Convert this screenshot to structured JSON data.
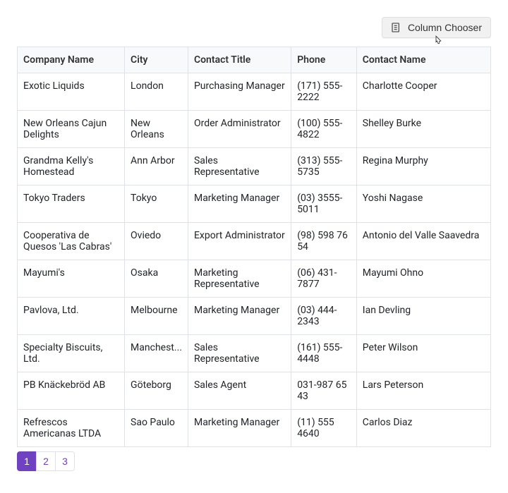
{
  "toolbar": {
    "column_chooser_label": "Column Chooser"
  },
  "columns": [
    {
      "key": "company",
      "label": "Company Name"
    },
    {
      "key": "city",
      "label": "City"
    },
    {
      "key": "contact_title",
      "label": "Contact Title"
    },
    {
      "key": "phone",
      "label": "Phone"
    },
    {
      "key": "contact_name",
      "label": "Contact Name"
    }
  ],
  "rows": [
    {
      "company": "Exotic Liquids",
      "city": "London",
      "contact_title": "Purchasing Manager",
      "phone": "(171) 555-2222",
      "contact_name": "Charlotte Cooper"
    },
    {
      "company": "New Orleans Cajun Delights",
      "city": "New Orleans",
      "contact_title": "Order Administrator",
      "phone": "(100) 555-4822",
      "contact_name": "Shelley Burke"
    },
    {
      "company": "Grandma Kelly's Homestead",
      "city": "Ann Arbor",
      "contact_title": "Sales Representative",
      "phone": "(313) 555-5735",
      "contact_name": "Regina Murphy"
    },
    {
      "company": "Tokyo Traders",
      "city": "Tokyo",
      "contact_title": "Marketing Manager",
      "phone": "(03) 3555-5011",
      "contact_name": "Yoshi Nagase"
    },
    {
      "company": "Cooperativa de Quesos 'Las Cabras'",
      "city": "Oviedo",
      "contact_title": "Export Administrator",
      "phone": "(98) 598 76 54",
      "contact_name": "Antonio del Valle Saavedra"
    },
    {
      "company": "Mayumi's",
      "city": "Osaka",
      "contact_title": "Marketing Representative",
      "phone": "(06) 431-7877",
      "contact_name": "Mayumi Ohno"
    },
    {
      "company": "Pavlova, Ltd.",
      "city": "Melbourne",
      "contact_title": "Marketing Manager",
      "phone": "(03) 444-2343",
      "contact_name": "Ian Devling"
    },
    {
      "company": "Specialty Biscuits, Ltd.",
      "city": "Manchest...",
      "contact_title": "Sales Representative",
      "phone": "(161) 555-4448",
      "contact_name": "Peter Wilson"
    },
    {
      "company": "PB Knäckebröd AB",
      "city": "Göteborg",
      "contact_title": "Sales Agent",
      "phone": "031-987 65 43",
      "contact_name": "Lars Peterson"
    },
    {
      "company": "Refrescos Americanas LTDA",
      "city": "Sao Paulo",
      "contact_title": "Marketing Manager",
      "phone": "(11) 555 4640",
      "contact_name": "Carlos Diaz"
    }
  ],
  "pager": {
    "pages": [
      1,
      2,
      3
    ],
    "current": 1
  },
  "colors": {
    "accent": "#6f42c1",
    "border": "#dee2e6",
    "header_bg": "#f8f9fa"
  }
}
